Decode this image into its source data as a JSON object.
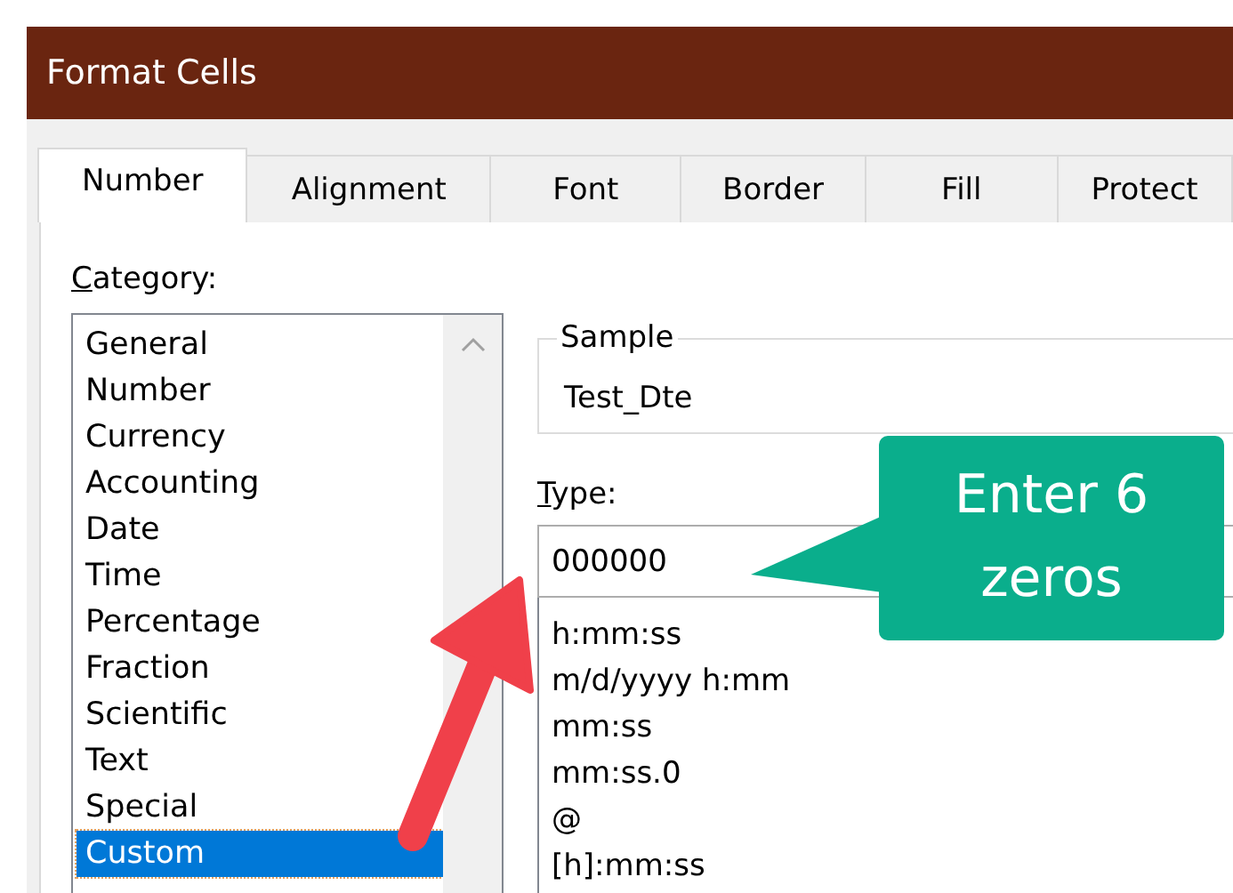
{
  "window": {
    "title": "Format Cells"
  },
  "tabs": [
    {
      "label": "Number",
      "selected": true
    },
    {
      "label": "Alignment",
      "selected": false
    },
    {
      "label": "Font",
      "selected": false
    },
    {
      "label": "Border",
      "selected": false
    },
    {
      "label": "Fill",
      "selected": false
    },
    {
      "label": "Protect",
      "selected": false
    }
  ],
  "category": {
    "label": "Category:",
    "items": [
      {
        "label": "General",
        "selected": false
      },
      {
        "label": "Number",
        "selected": false
      },
      {
        "label": "Currency",
        "selected": false
      },
      {
        "label": "Accounting",
        "selected": false
      },
      {
        "label": "Date",
        "selected": false
      },
      {
        "label": "Time",
        "selected": false
      },
      {
        "label": "Percentage",
        "selected": false
      },
      {
        "label": "Fraction",
        "selected": false
      },
      {
        "label": "Scientific",
        "selected": false
      },
      {
        "label": "Text",
        "selected": false
      },
      {
        "label": "Special",
        "selected": false
      },
      {
        "label": "Custom",
        "selected": true
      }
    ]
  },
  "sample": {
    "label": "Sample",
    "value": "Test_Dte"
  },
  "type": {
    "label": "Type:",
    "value": "000000",
    "formats": [
      "h:mm:ss",
      "m/d/yyyy h:mm",
      "mm:ss",
      "mm:ss.0",
      "@",
      "[h]:mm:ss"
    ]
  },
  "callout": {
    "text": "Enter 6 zeros"
  }
}
